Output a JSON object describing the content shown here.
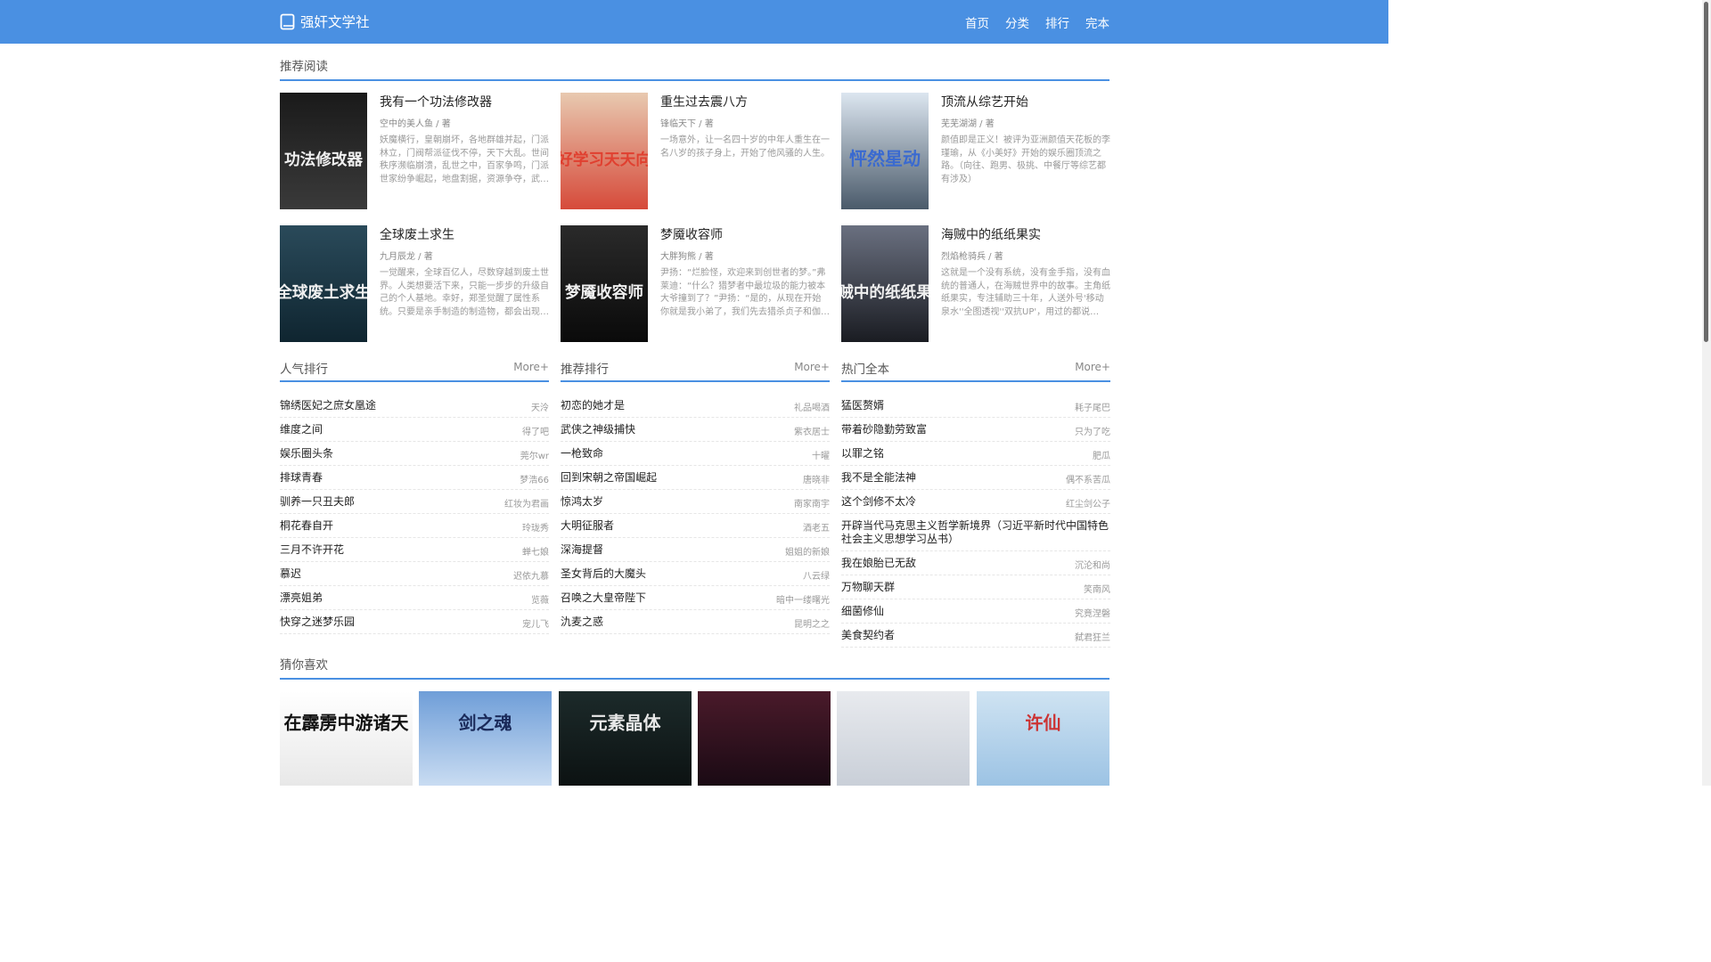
{
  "site": {
    "name": "强奸文学社"
  },
  "nav": [
    {
      "label": "首页"
    },
    {
      "label": "分类"
    },
    {
      "label": "排行"
    },
    {
      "label": "完本"
    }
  ],
  "sections": {
    "recommend": "推荐阅读",
    "popular": "人气排行",
    "ranking": "推荐排行",
    "completed": "热门全本",
    "guess": "猜你喜欢",
    "more": "More+"
  },
  "recommend": [
    {
      "title": "我有一个功法修改器",
      "author": "空中的美人鱼 / 著",
      "desc": "妖魔横行，皇朝崩坏，各地群雄并起，门派林立，门阀帮派征伐不停，天下大乱。世间秩序濒临崩溃，乱世之中，百家争鸣，门派世家纷争崛起，地盘割据，资源争夺，武…",
      "cover_text": "功法修改器",
      "colors": [
        "#1a1a1a",
        "#3a3a3a"
      ]
    },
    {
      "title": "重生过去震八方",
      "author": "锋临天下 / 著",
      "desc": "一场意外，让一名四十岁的中年人重生在一名八岁的孩子身上，开始了他风骚的人生。",
      "cover_text": "好好学习天天向上",
      "colors": [
        "#e8c9b0",
        "#d64a3a"
      ]
    },
    {
      "title": "顶流从综艺开始",
      "author": "芜芜湖湖 / 著",
      "desc": "颜值即是正义！被评为亚洲颜值天花板的李瑾瑜，从《小美好》开始的娱乐圈顶流之路。（向往、跑男、极挑、中餐厅等综艺都有涉及）",
      "cover_text": "怦然星动",
      "colors": [
        "#dce6f0",
        "#4a5a6a"
      ]
    },
    {
      "title": "全球废土求生",
      "author": "九月辰龙 / 著",
      "desc": "一觉醒来，全球百亿人，尽数穿越到废土世界。人类想要活下来，只能一步步的升级自己的个人基地。幸好，郑圣觉醒了属性系统。只要是亲手制造的制造物，都会出现…",
      "cover_text": "全球废土求生",
      "colors": [
        "#2a4a5a",
        "#0f2530"
      ]
    },
    {
      "title": "梦魇收容师",
      "author": "大胖狗熊 / 著",
      "desc": "尹扬：“烂脸怪，欢迎来到创世者的梦。”弗莱迪：“什么？猎梦者中最垃圾的能力被本大爷撞到了？”尹扬：“是的，从现在开始你就是我小弟了，我们先去猎杀贞子和伽椰子，…",
      "cover_text": "梦魇收容师",
      "colors": [
        "#2a2a2a",
        "#0a0a0a"
      ]
    },
    {
      "title": "海贼中的纸纸果实",
      "author": "烈焰枪骑兵 / 著",
      "desc": "这就是一个没有系统，没有金手指，没有血统的普通人，在海贼世界中的故事。主角纸纸果实，专注辅助三十年，人送外号'移动泉水''全图透视''双抗UP'，用过的都说好！…",
      "cover_text": "海贼中的纸纸果实",
      "colors": [
        "#6a7080",
        "#1a1c22"
      ]
    }
  ],
  "popular": [
    {
      "t": "锦绣医妃之庶女凰途",
      "a": "天泠"
    },
    {
      "t": "维度之间",
      "a": "得了吧"
    },
    {
      "t": "娱乐圈头条",
      "a": "莞尔wr"
    },
    {
      "t": "排球青春",
      "a": "梦浩66"
    },
    {
      "t": "驯养一只丑夫郎",
      "a": "红妆为君画"
    },
    {
      "t": "桐花春自开",
      "a": "玲珑秀"
    },
    {
      "t": "三月不许开花",
      "a": "蝉七娘"
    },
    {
      "t": "慕迟",
      "a": "迟依九慕"
    },
    {
      "t": "漂亮姐弟",
      "a": "览薇"
    },
    {
      "t": "快穿之迷梦乐园",
      "a": "宠儿飞"
    }
  ],
  "ranking": [
    {
      "t": "初恋的她才是",
      "a": "礼品喝酒"
    },
    {
      "t": "武侠之神级捕快",
      "a": "紫衣居士"
    },
    {
      "t": "一枪致命",
      "a": "十曜"
    },
    {
      "t": "回到宋朝之帝国崛起",
      "a": "唐晓非"
    },
    {
      "t": "惊鸿太岁",
      "a": "南家南宇"
    },
    {
      "t": "大明征服者",
      "a": "酒老五"
    },
    {
      "t": "深海提督",
      "a": "姐姐的新娘"
    },
    {
      "t": "圣女背后的大魔头",
      "a": "八云绿"
    },
    {
      "t": "召唤之大皇帝陛下",
      "a": "暗中一缕曙光"
    },
    {
      "t": "氿麦之惑",
      "a": "昆明之之"
    }
  ],
  "completed": [
    {
      "t": "猛医赘婿",
      "a": "耗子尾巴"
    },
    {
      "t": "带着砂隐勤劳致富",
      "a": "只为了吃"
    },
    {
      "t": "以罪之铭",
      "a": "肥瓜"
    },
    {
      "t": "我不是全能法神",
      "a": "偶不系苦瓜"
    },
    {
      "t": "这个剑修不太冷",
      "a": "红尘剑公子"
    },
    {
      "t": "开辟当代马克思主义哲学新境界（习近平新时代中国特色社会主义思想学习丛书）",
      "a": ""
    },
    {
      "t": "我在娘胎已无敌",
      "a": "沉沦和尚"
    },
    {
      "t": "万物聊天群",
      "a": "笑南风"
    },
    {
      "t": "细菌修仙",
      "a": "究竟涅磐"
    },
    {
      "t": "美食契约者",
      "a": "弑君狂兰"
    }
  ],
  "guess": [
    {
      "cover_text": "在霹雳中游诸天",
      "colors": [
        "#ffffff",
        "#e8e8e8"
      ],
      "fg": "#111"
    },
    {
      "cover_text": "剑之魂",
      "colors": [
        "#6f9ed8",
        "#c9dcf2"
      ],
      "fg": "#1a2a5a"
    },
    {
      "cover_text": "元素晶体",
      "colors": [
        "#1c2a2a",
        "#0c1212"
      ],
      "fg": "#e8e8e8"
    },
    {
      "cover_text": "",
      "colors": [
        "#4a1a2a",
        "#1a0a14"
      ],
      "fg": "#ddd"
    },
    {
      "cover_text": "",
      "colors": [
        "#e8eaee",
        "#c9cfd8"
      ],
      "fg": "#556"
    },
    {
      "cover_text": "许仙",
      "colors": [
        "#cfe3f2",
        "#9cc3e4"
      ],
      "fg": "#c33"
    }
  ]
}
